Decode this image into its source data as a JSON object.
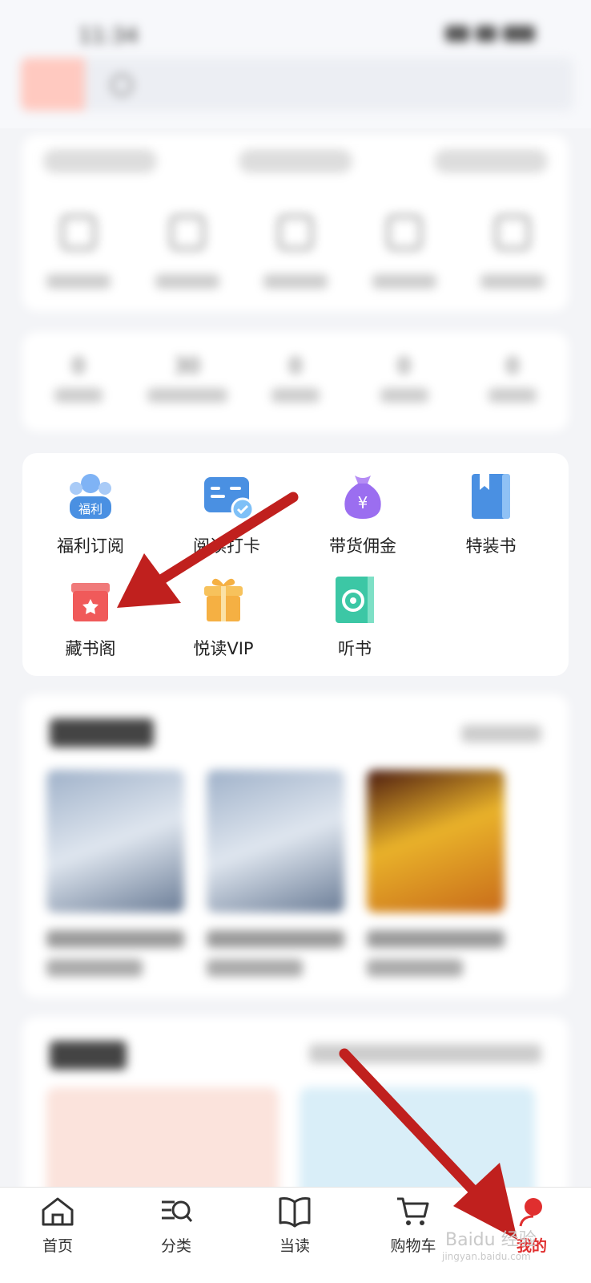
{
  "status_bar": {
    "time": "11:34"
  },
  "services": [
    {
      "label": "福利订阅",
      "icon": "welfare-subscribe-icon",
      "icon_text": "福利"
    },
    {
      "label": "阅读打卡",
      "icon": "reading-checkin-icon"
    },
    {
      "label": "带货佣金",
      "icon": "commission-moneybag-icon",
      "icon_text": "¥"
    },
    {
      "label": "特装书",
      "icon": "special-edition-book-icon"
    },
    {
      "label": "藏书阁",
      "icon": "library-gift-box-icon"
    },
    {
      "label": "悦读VIP",
      "icon": "vip-gift-icon"
    },
    {
      "label": "听书",
      "icon": "audiobook-icon"
    }
  ],
  "bottom_nav": [
    {
      "label": "首页",
      "icon": "home-icon"
    },
    {
      "label": "分类",
      "icon": "category-search-icon"
    },
    {
      "label": "当读",
      "icon": "open-book-icon"
    },
    {
      "label": "购物车",
      "icon": "shopping-cart-icon"
    },
    {
      "label": "我的",
      "icon": "profile-icon",
      "active": true
    }
  ],
  "colors": {
    "accent_red": "#e02f2f",
    "arrow_red": "#c0201e",
    "service_blue": "#4a90e2",
    "gift_red": "#f05a5a",
    "gift_orange": "#f5b043",
    "audio_teal": "#3cc7a5",
    "bag_purple": "#9b6ef0"
  }
}
